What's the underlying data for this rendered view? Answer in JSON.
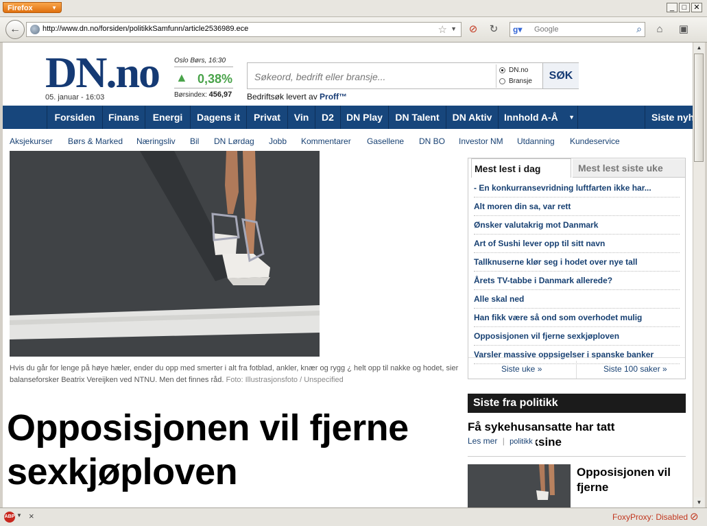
{
  "browser": {
    "menu_button": "Firefox",
    "url": "http://www.dn.no/forsiden/politikkSamfunn/article2536989.ece",
    "search_placeholder": "Google",
    "status_right": "FoxyProxy: Disabled",
    "window_buttons": [
      "_",
      "□",
      "✕"
    ]
  },
  "site": {
    "logo": "DN.no",
    "date": "05. januar - 16:03",
    "ticker": {
      "label": "Oslo Børs, 16:30",
      "change": "0,38%",
      "index_label": "Børsindex:",
      "index_value": "456,97",
      "direction": "up"
    },
    "search": {
      "placeholder": "Søkeord, bedrift eller bransje...",
      "options": [
        "DN.no",
        "Bransje"
      ],
      "selected": "DN.no",
      "button": "SØK",
      "provider_prefix": "Bedriftsøk levert av",
      "provider": "Proff™"
    },
    "main_nav": [
      "Forsiden",
      "Finans",
      "Energi",
      "Dagens it",
      "Privat",
      "Vin",
      "D2",
      "DN Play",
      "DN Talent",
      "DN Aktiv",
      "Innhold A-Å",
      "Siste nyh"
    ],
    "sub_nav": [
      "Aksjekurser",
      "Børs & Marked",
      "Næringsliv",
      "Bil",
      "DN Lørdag",
      "Jobb",
      "Kommentarer",
      "Gasellene",
      "DN BO",
      "Investor NM",
      "Utdanning",
      "Kundeservice"
    ]
  },
  "article": {
    "caption": "Hvis du går for lenge på høye hæler, ender du opp med smerter i alt fra fotblad, ankler, knær og rygg ¿ helt opp til nakke og hodet, sier balanseforsker Beatrix Vereijken ved NTNU. Men det finnes råd.",
    "credit": "Foto: Illustrasjonsfoto / Unspecified",
    "headline": "Opposisjonen vil fjerne sexkjøploven"
  },
  "most_read": {
    "tab_active": "Mest lest i dag",
    "tab_inactive": "Mest lest siste uke",
    "items": [
      "- En konkurransevridning luftfarten ikke har...",
      "Alt moren din sa, var rett",
      "Ønsker valutakrig mot Danmark",
      "Art of Sushi lever opp til sitt navn",
      "Tallknuserne klør seg i hodet over nye tall",
      "Årets TV-tabbe i Danmark allerede?",
      "Alle skal ned",
      "Han fikk være så ond som overhodet mulig",
      "Opposisjonen vil fjerne sexkjøploven",
      "Varsler massive oppsigelser i spanske banker"
    ],
    "footer_left": "Siste uke »",
    "footer_right": "Siste 100 saker »"
  },
  "siste": {
    "header": "Siste fra politikk",
    "item1_title": "Få sykehusansatte har tatt influensavaksine",
    "item1_more": "Les mer",
    "item1_category": "politikk",
    "item2_title": "Opposisjonen vil fjerne"
  }
}
